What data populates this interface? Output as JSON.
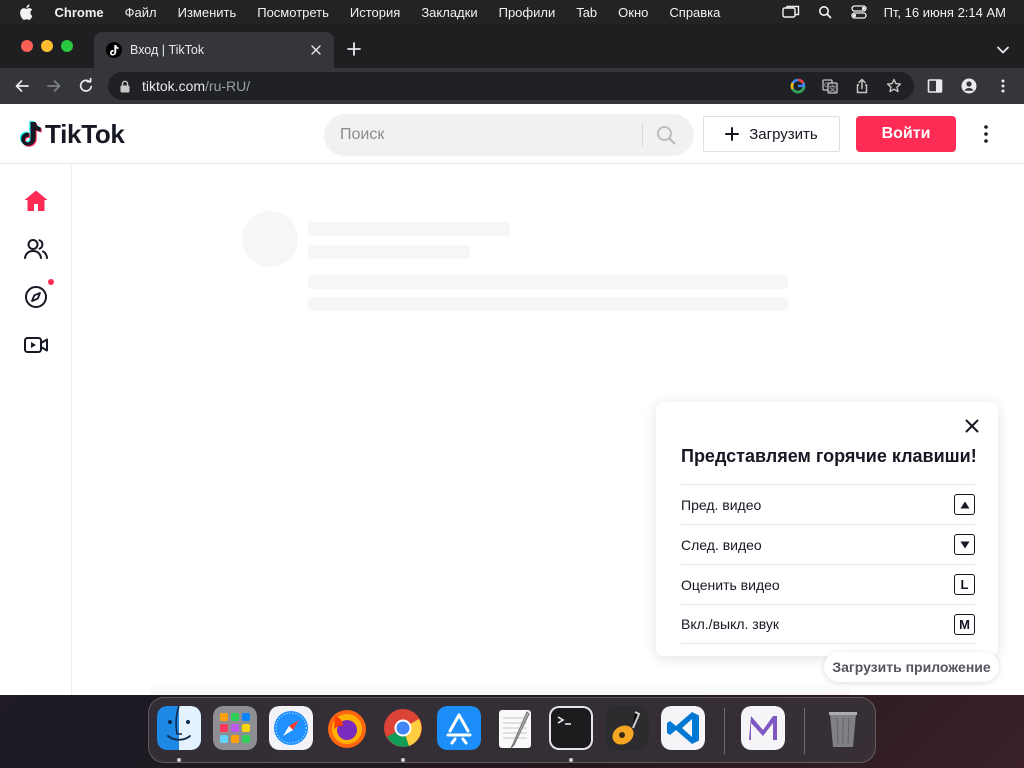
{
  "menubar": {
    "app_name": "Chrome",
    "items": [
      "Файл",
      "Изменить",
      "Посмотреть",
      "История",
      "Закладки",
      "Профили",
      "Tab",
      "Окно",
      "Справка"
    ],
    "clock": "Пт, 16 июня  2:14 AM"
  },
  "browser": {
    "tab_title": "Вход | TikTok",
    "url_host": "tiktok.com",
    "url_path": "/ru-RU/"
  },
  "tiktok": {
    "logo_text": "TikTok",
    "search_placeholder": "Поиск",
    "upload_label": "Загрузить",
    "login_label": "Войти",
    "accent_color": "#fe2c55",
    "shortcuts": {
      "title": "Представляем горячие клавиши!",
      "rows": [
        {
          "label": "Пред. видео",
          "key": "up-arrow"
        },
        {
          "label": "След. видео",
          "key": "down-arrow"
        },
        {
          "label": "Оценить видео",
          "key": "L"
        },
        {
          "label": "Вкл./выкл. звук",
          "key": "M"
        }
      ]
    },
    "get_app_label": "Загрузить приложение"
  },
  "dock": {
    "apps": [
      "finder-icon",
      "launchpad-icon",
      "safari-icon",
      "firefox-icon",
      "chrome-icon",
      "app-store-icon",
      "textedit-icon",
      "terminal-icon",
      "garageband-icon",
      "vscode-icon",
      "visual-studio-icon",
      "trash-icon"
    ]
  }
}
